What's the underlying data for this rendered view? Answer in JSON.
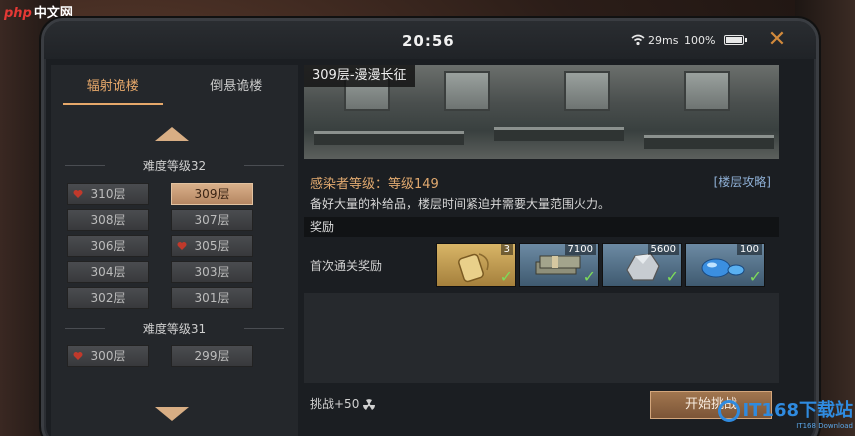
{
  "site_logo": {
    "prefix": "php",
    "name": "中文网"
  },
  "status": {
    "time": "20:56",
    "ping": "29ms",
    "battery": "100%"
  },
  "tabs": [
    {
      "label": "辐射诡楼",
      "active": true
    },
    {
      "label": "倒悬诡楼",
      "active": false
    }
  ],
  "groups": [
    {
      "title": "难度等级32"
    },
    {
      "title": "难度等级31"
    }
  ],
  "floors": [
    {
      "label": "310层",
      "heart": true
    },
    {
      "label": "309层",
      "selected": true
    },
    {
      "label": "308层"
    },
    {
      "label": "307层"
    },
    {
      "label": "306层"
    },
    {
      "label": "305层",
      "heart": true
    },
    {
      "label": "304层"
    },
    {
      "label": "303层"
    },
    {
      "label": "302层"
    },
    {
      "label": "301层"
    },
    {
      "label": "300层",
      "heart": true
    },
    {
      "label": "299层"
    }
  ],
  "detail": {
    "title": "309层-漫漫长征",
    "infected_level": "感染者等级：等级149",
    "guide": "[楼层攻略]",
    "description": "备好大量的补给品，楼层时间紧迫并需要大量范围火力。",
    "reward_header": "奖励",
    "first_clear_label": "首次通关奖励",
    "rewards": [
      {
        "icon": "dog-tag-icon",
        "count": "3",
        "color": "#c7a255"
      },
      {
        "icon": "cash-stack-icon",
        "count": "7100",
        "color": "#5d7f9b"
      },
      {
        "icon": "metal-ore-icon",
        "count": "5600",
        "color": "#5d7f9b"
      },
      {
        "icon": "blue-crystal-icon",
        "count": "100",
        "color": "#5d7f9b"
      }
    ],
    "challenge": "挑战+50",
    "start_label": "开始挑战"
  },
  "watermark": {
    "text": "IT168下载站",
    "sub": "IT168 Download"
  }
}
